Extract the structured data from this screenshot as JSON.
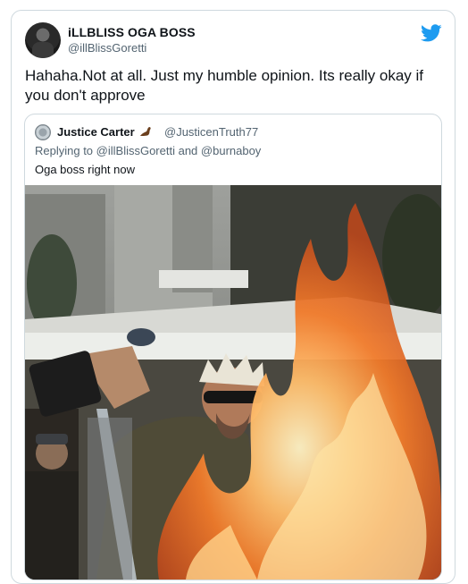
{
  "tweet": {
    "author_name": "iLLBLISS OGA BOSS",
    "author_handle": "@illBlissGoretti",
    "text": "Hahaha.Not at all. Just my humble opinion. Its really okay if you don't approve"
  },
  "quoted_tweet": {
    "author_name": "Justice Carter",
    "author_handle": "@JusticenTruth77",
    "replying_prefix": "Replying to ",
    "reply_to_1": "@illBlissGoretti",
    "reply_joiner": " and ",
    "reply_to_2": "@burnaboy",
    "text": "Oga boss right now"
  },
  "icons": {
    "brand": "twitter-bird-icon",
    "name_emoji": "muscle-arm-emoji-icon"
  },
  "colors": {
    "brand_blue": "#1d9bf0",
    "border": "#cfd9de",
    "secondary_text": "#536471"
  }
}
